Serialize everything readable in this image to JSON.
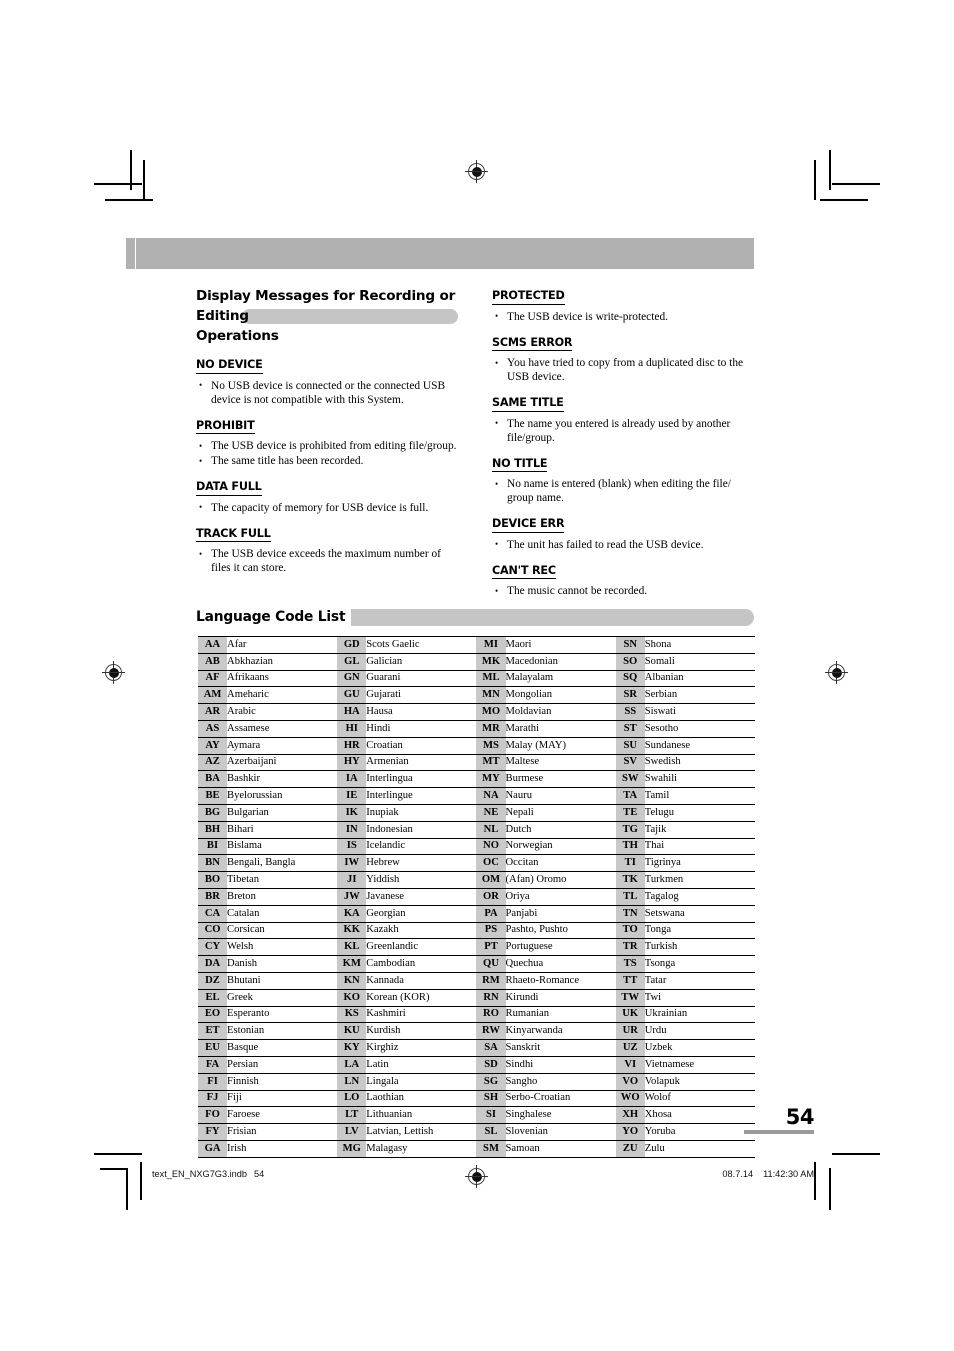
{
  "page": {
    "number": "54",
    "footer_left_file": "text_EN_NXG7G3.indb",
    "footer_left_page": "54",
    "footer_right_date": "08.7.14",
    "footer_right_time": "11:42:30 AM"
  },
  "messages_section": {
    "title_line1": "Display Messages for Recording or Editing",
    "title_line2": "Operations",
    "left_column": [
      {
        "heading": "NO DEVICE",
        "bullets": [
          "No USB device is connected or the connected USB device is not compatible with this System."
        ]
      },
      {
        "heading": "PROHIBIT",
        "bullets": [
          "The USB device is prohibited from editing file/group.",
          "The same title has been recorded."
        ]
      },
      {
        "heading": "DATA FULL",
        "bullets": [
          "The capacity of memory for USB device is full."
        ]
      },
      {
        "heading": "TRACK FULL",
        "bullets": [
          "The USB device exceeds the maximum number of files it can store."
        ]
      }
    ],
    "right_column": [
      {
        "heading": "PROTECTED",
        "bullets": [
          "The USB device is write-protected."
        ]
      },
      {
        "heading": "SCMS ERROR",
        "bullets": [
          "You have tried to copy from a duplicated disc to the USB device."
        ]
      },
      {
        "heading": "SAME TITLE",
        "bullets": [
          "The name you entered is already used by another file/group."
        ]
      },
      {
        "heading": "NO TITLE",
        "bullets": [
          "No name is entered (blank) when editing the file/ group name."
        ]
      },
      {
        "heading": "DEVICE ERR",
        "bullets": [
          "The unit has failed to read the USB device."
        ]
      },
      {
        "heading": "CAN'T REC",
        "bullets": [
          "The music cannot be recorded."
        ]
      }
    ]
  },
  "language_code_list": {
    "title": "Language Code List",
    "columns": [
      [
        {
          "code": "AA",
          "name": "Afar"
        },
        {
          "code": "AB",
          "name": "Abkhazian"
        },
        {
          "code": "AF",
          "name": "Afrikaans"
        },
        {
          "code": "AM",
          "name": "Ameharic"
        },
        {
          "code": "AR",
          "name": "Arabic"
        },
        {
          "code": "AS",
          "name": "Assamese"
        },
        {
          "code": "AY",
          "name": "Aymara"
        },
        {
          "code": "AZ",
          "name": "Azerbaijani"
        },
        {
          "code": "BA",
          "name": "Bashkir"
        },
        {
          "code": "BE",
          "name": "Byelorussian"
        },
        {
          "code": "BG",
          "name": "Bulgarian"
        },
        {
          "code": "BH",
          "name": "Bihari"
        },
        {
          "code": "BI",
          "name": "Bislama"
        },
        {
          "code": "BN",
          "name": "Bengali, Bangla"
        },
        {
          "code": "BO",
          "name": "Tibetan"
        },
        {
          "code": "BR",
          "name": "Breton"
        },
        {
          "code": "CA",
          "name": "Catalan"
        },
        {
          "code": "CO",
          "name": "Corsican"
        },
        {
          "code": "CY",
          "name": "Welsh"
        },
        {
          "code": "DA",
          "name": "Danish"
        },
        {
          "code": "DZ",
          "name": "Bhutani"
        },
        {
          "code": "EL",
          "name": "Greek"
        },
        {
          "code": "EO",
          "name": "Esperanto"
        },
        {
          "code": "ET",
          "name": "Estonian"
        },
        {
          "code": "EU",
          "name": "Basque"
        },
        {
          "code": "FA",
          "name": "Persian"
        },
        {
          "code": "FI",
          "name": "Finnish"
        },
        {
          "code": "FJ",
          "name": "Fiji"
        },
        {
          "code": "FO",
          "name": "Faroese"
        },
        {
          "code": "FY",
          "name": "Frisian"
        },
        {
          "code": "GA",
          "name": "Irish"
        }
      ],
      [
        {
          "code": "GD",
          "name": "Scots Gaelic"
        },
        {
          "code": "GL",
          "name": "Galician"
        },
        {
          "code": "GN",
          "name": "Guarani"
        },
        {
          "code": "GU",
          "name": "Gujarati"
        },
        {
          "code": "HA",
          "name": "Hausa"
        },
        {
          "code": "HI",
          "name": "Hindi"
        },
        {
          "code": "HR",
          "name": "Croatian"
        },
        {
          "code": "HY",
          "name": "Armenian"
        },
        {
          "code": "IA",
          "name": "Interlingua"
        },
        {
          "code": "IE",
          "name": "Interlingue"
        },
        {
          "code": "IK",
          "name": "Inupiak"
        },
        {
          "code": "IN",
          "name": "Indonesian"
        },
        {
          "code": "IS",
          "name": "Icelandic"
        },
        {
          "code": "IW",
          "name": "Hebrew"
        },
        {
          "code": "JI",
          "name": "Yiddish"
        },
        {
          "code": "JW",
          "name": "Javanese"
        },
        {
          "code": "KA",
          "name": "Georgian"
        },
        {
          "code": "KK",
          "name": "Kazakh"
        },
        {
          "code": "KL",
          "name": "Greenlandic"
        },
        {
          "code": "KM",
          "name": "Cambodian"
        },
        {
          "code": "KN",
          "name": "Kannada"
        },
        {
          "code": "KO",
          "name": "Korean (KOR)"
        },
        {
          "code": "KS",
          "name": "Kashmiri"
        },
        {
          "code": "KU",
          "name": "Kurdish"
        },
        {
          "code": "KY",
          "name": "Kirghiz"
        },
        {
          "code": "LA",
          "name": "Latin"
        },
        {
          "code": "LN",
          "name": "Lingala"
        },
        {
          "code": "LO",
          "name": "Laothian"
        },
        {
          "code": "LT",
          "name": "Lithuanian"
        },
        {
          "code": "LV",
          "name": "Latvian, Lettish"
        },
        {
          "code": "MG",
          "name": "Malagasy"
        }
      ],
      [
        {
          "code": "MI",
          "name": "Maori"
        },
        {
          "code": "MK",
          "name": "Macedonian"
        },
        {
          "code": "ML",
          "name": "Malayalam"
        },
        {
          "code": "MN",
          "name": "Mongolian"
        },
        {
          "code": "MO",
          "name": "Moldavian"
        },
        {
          "code": "MR",
          "name": "Marathi"
        },
        {
          "code": "MS",
          "name": "Malay (MAY)"
        },
        {
          "code": "MT",
          "name": "Maltese"
        },
        {
          "code": "MY",
          "name": "Burmese"
        },
        {
          "code": "NA",
          "name": "Nauru"
        },
        {
          "code": "NE",
          "name": "Nepali"
        },
        {
          "code": "NL",
          "name": "Dutch"
        },
        {
          "code": "NO",
          "name": "Norwegian"
        },
        {
          "code": "OC",
          "name": "Occitan"
        },
        {
          "code": "OM",
          "name": "(Afan) Oromo"
        },
        {
          "code": "OR",
          "name": "Oriya"
        },
        {
          "code": "PA",
          "name": "Panjabi"
        },
        {
          "code": "PS",
          "name": "Pashto, Pushto"
        },
        {
          "code": "PT",
          "name": "Portuguese"
        },
        {
          "code": "QU",
          "name": "Quechua"
        },
        {
          "code": "RM",
          "name": "Rhaeto-Romance"
        },
        {
          "code": "RN",
          "name": "Kirundi"
        },
        {
          "code": "RO",
          "name": "Rumanian"
        },
        {
          "code": "RW",
          "name": "Kinyarwanda"
        },
        {
          "code": "SA",
          "name": "Sanskrit"
        },
        {
          "code": "SD",
          "name": "Sindhi"
        },
        {
          "code": "SG",
          "name": "Sangho"
        },
        {
          "code": "SH",
          "name": "Serbo-Croatian"
        },
        {
          "code": "SI",
          "name": "Singhalese"
        },
        {
          "code": "SL",
          "name": "Slovenian"
        },
        {
          "code": "SM",
          "name": "Samoan"
        }
      ],
      [
        {
          "code": "SN",
          "name": "Shona"
        },
        {
          "code": "SO",
          "name": "Somali"
        },
        {
          "code": "SQ",
          "name": "Albanian"
        },
        {
          "code": "SR",
          "name": "Serbian"
        },
        {
          "code": "SS",
          "name": "Siswati"
        },
        {
          "code": "ST",
          "name": "Sesotho"
        },
        {
          "code": "SU",
          "name": "Sundanese"
        },
        {
          "code": "SV",
          "name": "Swedish"
        },
        {
          "code": "SW",
          "name": "Swahili"
        },
        {
          "code": "TA",
          "name": "Tamil"
        },
        {
          "code": "TE",
          "name": "Telugu"
        },
        {
          "code": "TG",
          "name": "Tajik"
        },
        {
          "code": "TH",
          "name": "Thai"
        },
        {
          "code": "TI",
          "name": "Tigrinya"
        },
        {
          "code": "TK",
          "name": "Turkmen"
        },
        {
          "code": "TL",
          "name": "Tagalog"
        },
        {
          "code": "TN",
          "name": "Setswana"
        },
        {
          "code": "TO",
          "name": "Tonga"
        },
        {
          "code": "TR",
          "name": "Turkish"
        },
        {
          "code": "TS",
          "name": "Tsonga"
        },
        {
          "code": "TT",
          "name": "Tatar"
        },
        {
          "code": "TW",
          "name": "Twi"
        },
        {
          "code": "UK",
          "name": "Ukrainian"
        },
        {
          "code": "UR",
          "name": "Urdu"
        },
        {
          "code": "UZ",
          "name": "Uzbek"
        },
        {
          "code": "VI",
          "name": "Vietnamese"
        },
        {
          "code": "VO",
          "name": "Volapuk"
        },
        {
          "code": "WO",
          "name": "Wolof"
        },
        {
          "code": "XH",
          "name": "Xhosa"
        },
        {
          "code": "YO",
          "name": "Yoruba"
        },
        {
          "code": "ZU",
          "name": "Zulu"
        }
      ]
    ]
  }
}
